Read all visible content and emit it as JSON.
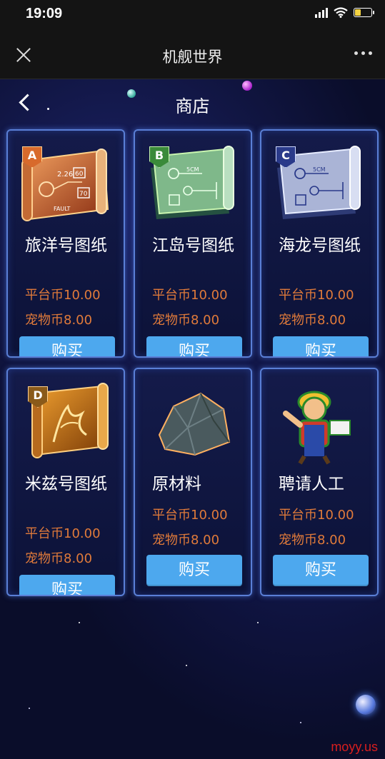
{
  "status": {
    "time": "19:09"
  },
  "nav": {
    "title": "机舰世界"
  },
  "shop": {
    "title": "商店"
  },
  "items": [
    {
      "name": "旅洋号图纸",
      "badge": "A",
      "price_platform": "平台币10.00",
      "price_pet": "宠物币8.00",
      "buy": "购买"
    },
    {
      "name": "江岛号图纸",
      "badge": "B",
      "price_platform": "平台币10.00",
      "price_pet": "宠物币8.00",
      "buy": "购买"
    },
    {
      "name": "海龙号图纸",
      "badge": "C",
      "price_platform": "平台币10.00",
      "price_pet": "宠物币8.00",
      "buy": "购买"
    },
    {
      "name": "米兹号图纸",
      "badge": "D",
      "price_platform": "平台币10.00",
      "price_pet": "宠物币8.00",
      "buy": "购买"
    },
    {
      "name": "原材料",
      "price_platform": "平台币10.00",
      "price_pet": "宠物币8.00",
      "buy": "购买"
    },
    {
      "name": "聘请人工",
      "price_platform": "平台币10.00",
      "price_pet": "宠物币8.00",
      "buy": "购买"
    }
  ],
  "blueprint_labels": {
    "a_value1": "2.26",
    "a_value2": "60",
    "a_value3": "70",
    "a_caption": "FAULT",
    "bc_scale": "5CM"
  },
  "watermark": "moyy.us",
  "colors": {
    "price": "#e07a3a",
    "button": "#4da8ee",
    "card_border": "#5a7fd6",
    "background": "#0a0d2a"
  }
}
